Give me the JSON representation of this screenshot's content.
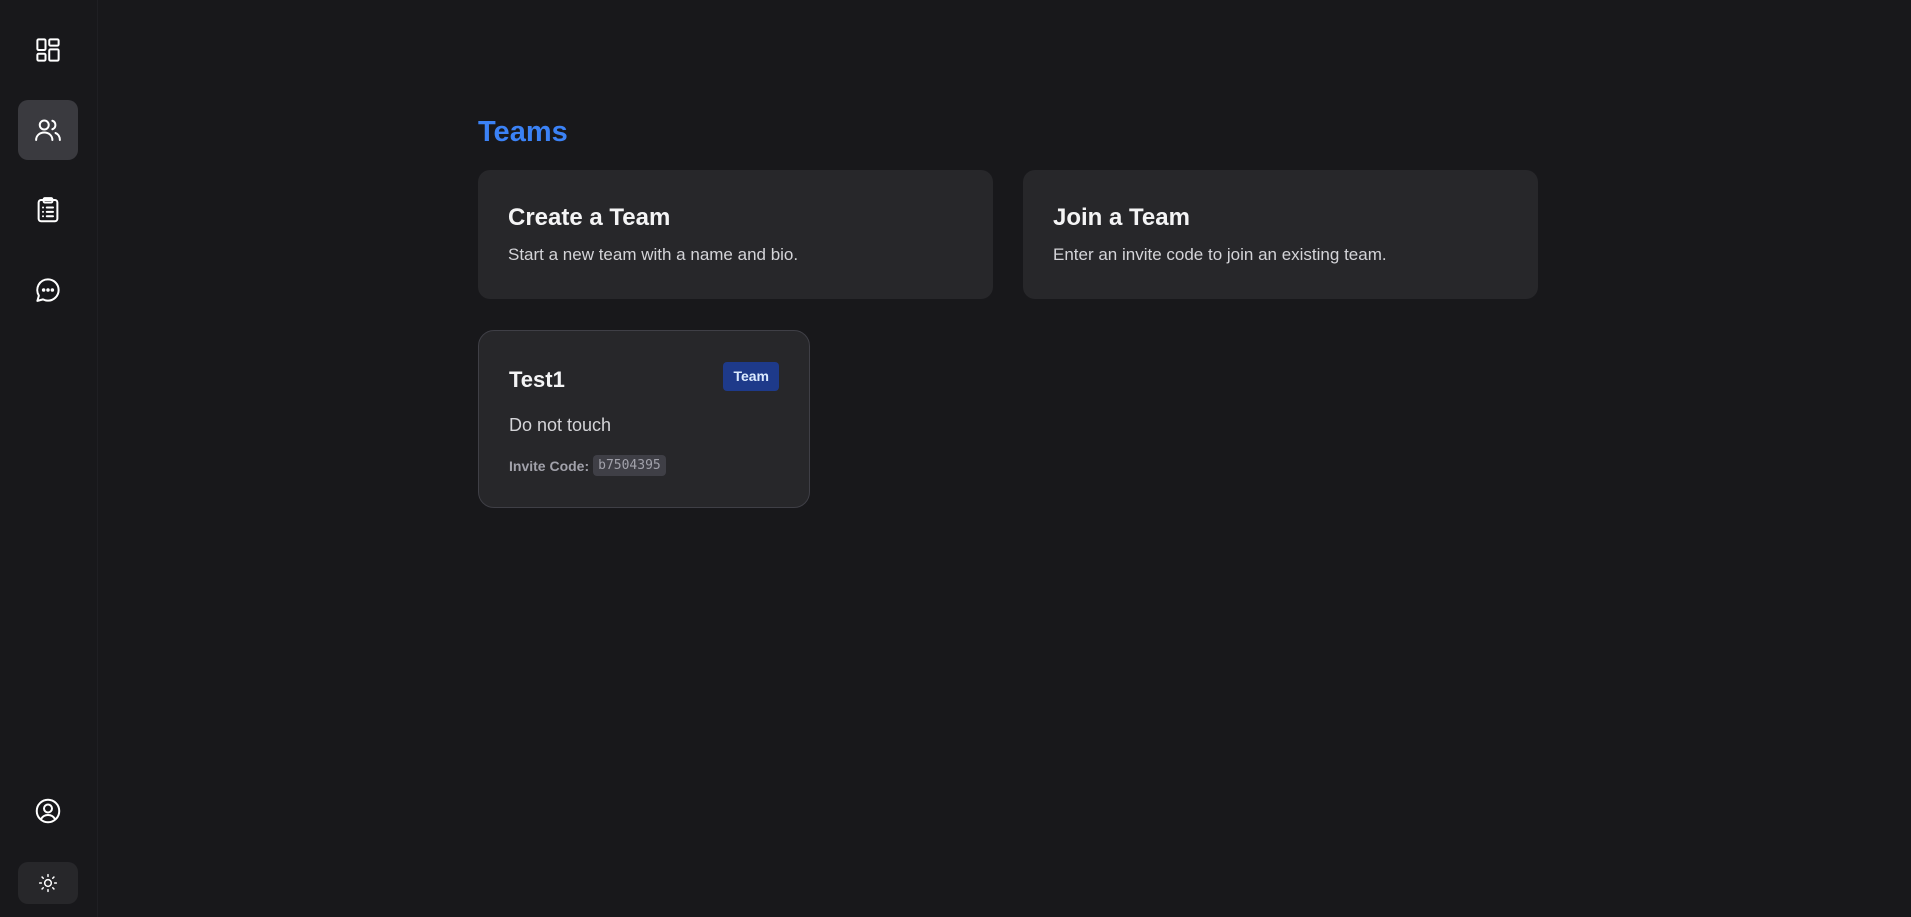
{
  "sidebar": {
    "items": [
      {
        "name": "dashboard",
        "icon": "dashboard-icon"
      },
      {
        "name": "teams",
        "icon": "users-icon",
        "active": true
      },
      {
        "name": "tasks",
        "icon": "clipboard-list-icon"
      },
      {
        "name": "chat",
        "icon": "chat-bubble-icon"
      }
    ],
    "profile_icon": "user-circle-icon",
    "theme_icon": "sun-icon"
  },
  "page": {
    "title": "Teams"
  },
  "actions": {
    "create": {
      "title": "Create a Team",
      "description": "Start a new team with a name and bio."
    },
    "join": {
      "title": "Join a Team",
      "description": "Enter an invite code to join an existing team."
    }
  },
  "teams": [
    {
      "name": "Test1",
      "badge": "Team",
      "bio": "Do not touch",
      "invite_label": "Invite Code:",
      "invite_code": "b7504395"
    }
  ],
  "colors": {
    "accent": "#3b82f6",
    "background": "#18181b",
    "card": "#27272a",
    "badge": "#1e3a8a"
  }
}
